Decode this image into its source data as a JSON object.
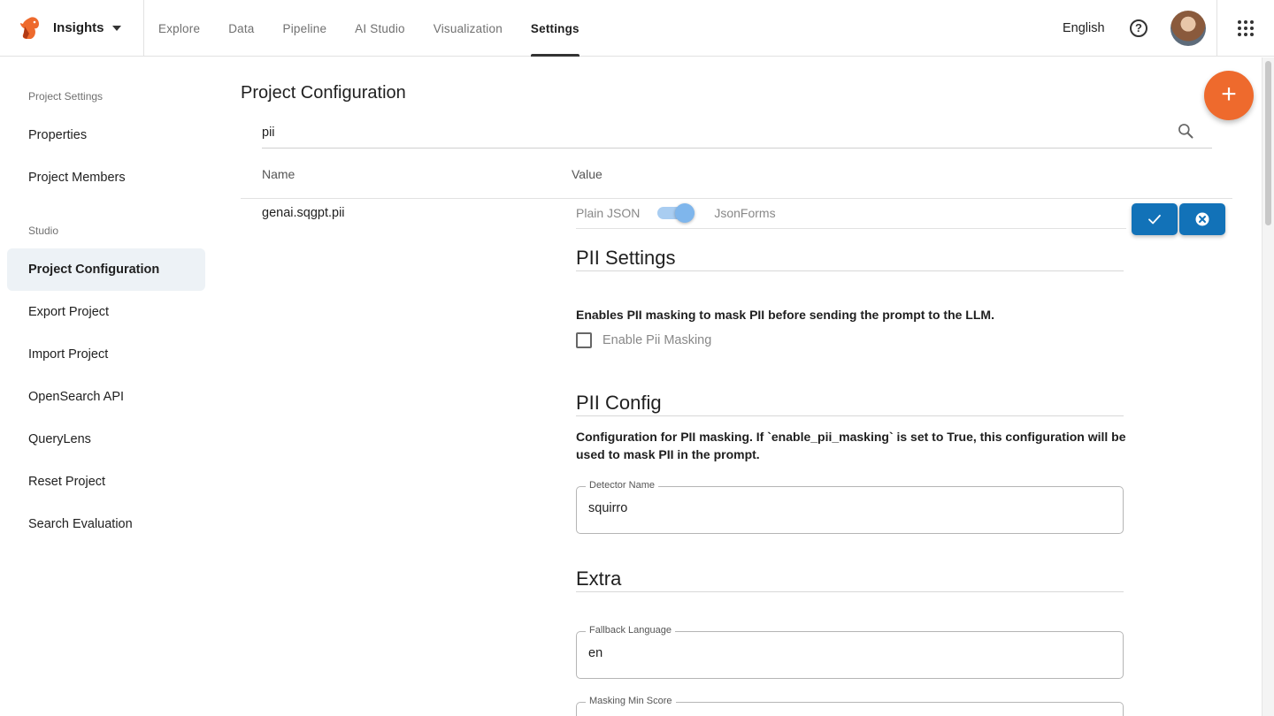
{
  "header": {
    "app_name": "Insights",
    "nav": [
      "Explore",
      "Data",
      "Pipeline",
      "AI Studio",
      "Visualization",
      "Settings"
    ],
    "active_tab": "Settings",
    "language": "English",
    "help_glyph": "?"
  },
  "sidebar": {
    "sections": [
      {
        "title": "Project Settings",
        "items": [
          "Properties",
          "Project Members"
        ]
      },
      {
        "title": "Studio",
        "items": [
          "Project Configuration",
          "Export Project",
          "Import Project",
          "OpenSearch API",
          "QueryLens",
          "Reset Project",
          "Search Evaluation"
        ]
      }
    ],
    "active_item": "Project Configuration"
  },
  "main": {
    "title": "Project Configuration",
    "fab_label": "+",
    "search": {
      "value": "pii",
      "placeholder": ""
    },
    "columns": {
      "name": "Name",
      "value": "Value"
    },
    "row": {
      "name": "genai.sqgpt.pii",
      "toggle": {
        "left_label": "Plain JSON",
        "right_label": "JsonForms",
        "on": true
      }
    },
    "pii_settings": {
      "title": "PII Settings",
      "description": "Enables PII masking to mask PII before sending the prompt to the LLM.",
      "checkbox_label": "Enable Pii Masking",
      "checked": false
    },
    "pii_config": {
      "title": "PII Config",
      "description": "Configuration for PII masking. If `enable_pii_masking` is set to True, this configuration will be used to mask PII in the prompt.",
      "detector_label": "Detector Name",
      "detector_value": "squirro"
    },
    "extra": {
      "title": "Extra",
      "fallback_label": "Fallback Language",
      "fallback_value": "en",
      "min_score_label": "Masking Min Score",
      "min_score_value": ""
    }
  },
  "colors": {
    "accent": "#ee6a2d",
    "primary": "#1272b8",
    "active_bg": "#edf2f6"
  }
}
